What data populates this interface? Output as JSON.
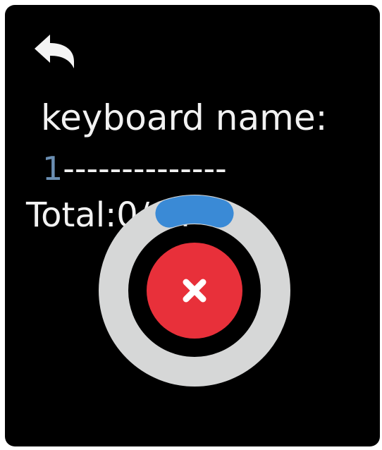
{
  "screen": {
    "back_icon": "back-arrow-icon",
    "keyboard_name_label": "keyboard name:",
    "keyboard_name_value": "1",
    "keyboard_name_placeholder": "--------------",
    "total_label": "Total:0/64"
  },
  "progress": {
    "icon": "circular-progress",
    "fraction": 0.1,
    "track_color": "#d6d7d7",
    "arc_color": "#3a8ad6"
  },
  "cancel": {
    "icon": "close-icon",
    "color": "#e8303a"
  }
}
